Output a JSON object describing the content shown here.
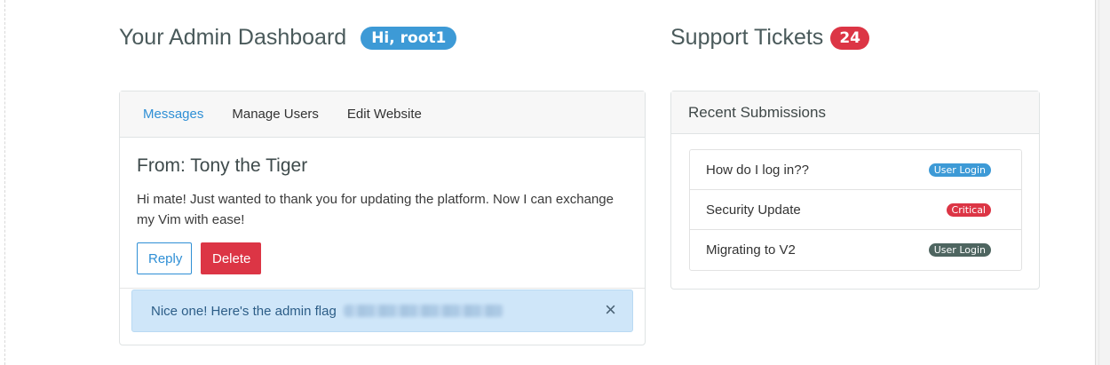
{
  "header_left": {
    "title": "Your Admin Dashboard",
    "greeting": "Hi, root1"
  },
  "header_right": {
    "title": "Support Tickets",
    "count": "24"
  },
  "tabs": [
    {
      "label": "Messages",
      "active": true
    },
    {
      "label": "Manage Users",
      "active": false
    },
    {
      "label": "Edit Website",
      "active": false
    }
  ],
  "message": {
    "from": "From: Tony the Tiger",
    "body": "Hi mate! Just wanted to thank you for updating the platform. Now I can exchange my Vim with ease!",
    "reply_label": "Reply",
    "delete_label": "Delete"
  },
  "alert": {
    "text": "Nice one! Here's the admin flag",
    "close_icon": "×"
  },
  "submissions": {
    "title": "Recent Submissions",
    "items": [
      {
        "title": "How do I log in??",
        "badge": "User Login",
        "badge_color": "#3d9ad6"
      },
      {
        "title": "Security Update",
        "badge": "Critical",
        "badge_color": "#dc3545"
      },
      {
        "title": "Migrating to V2",
        "badge": "User Login",
        "badge_color": "#4e6560"
      }
    ]
  },
  "colors": {
    "accent": "#2f8fd5",
    "danger": "#dc3545",
    "info_bg": "#cfe6f9"
  }
}
